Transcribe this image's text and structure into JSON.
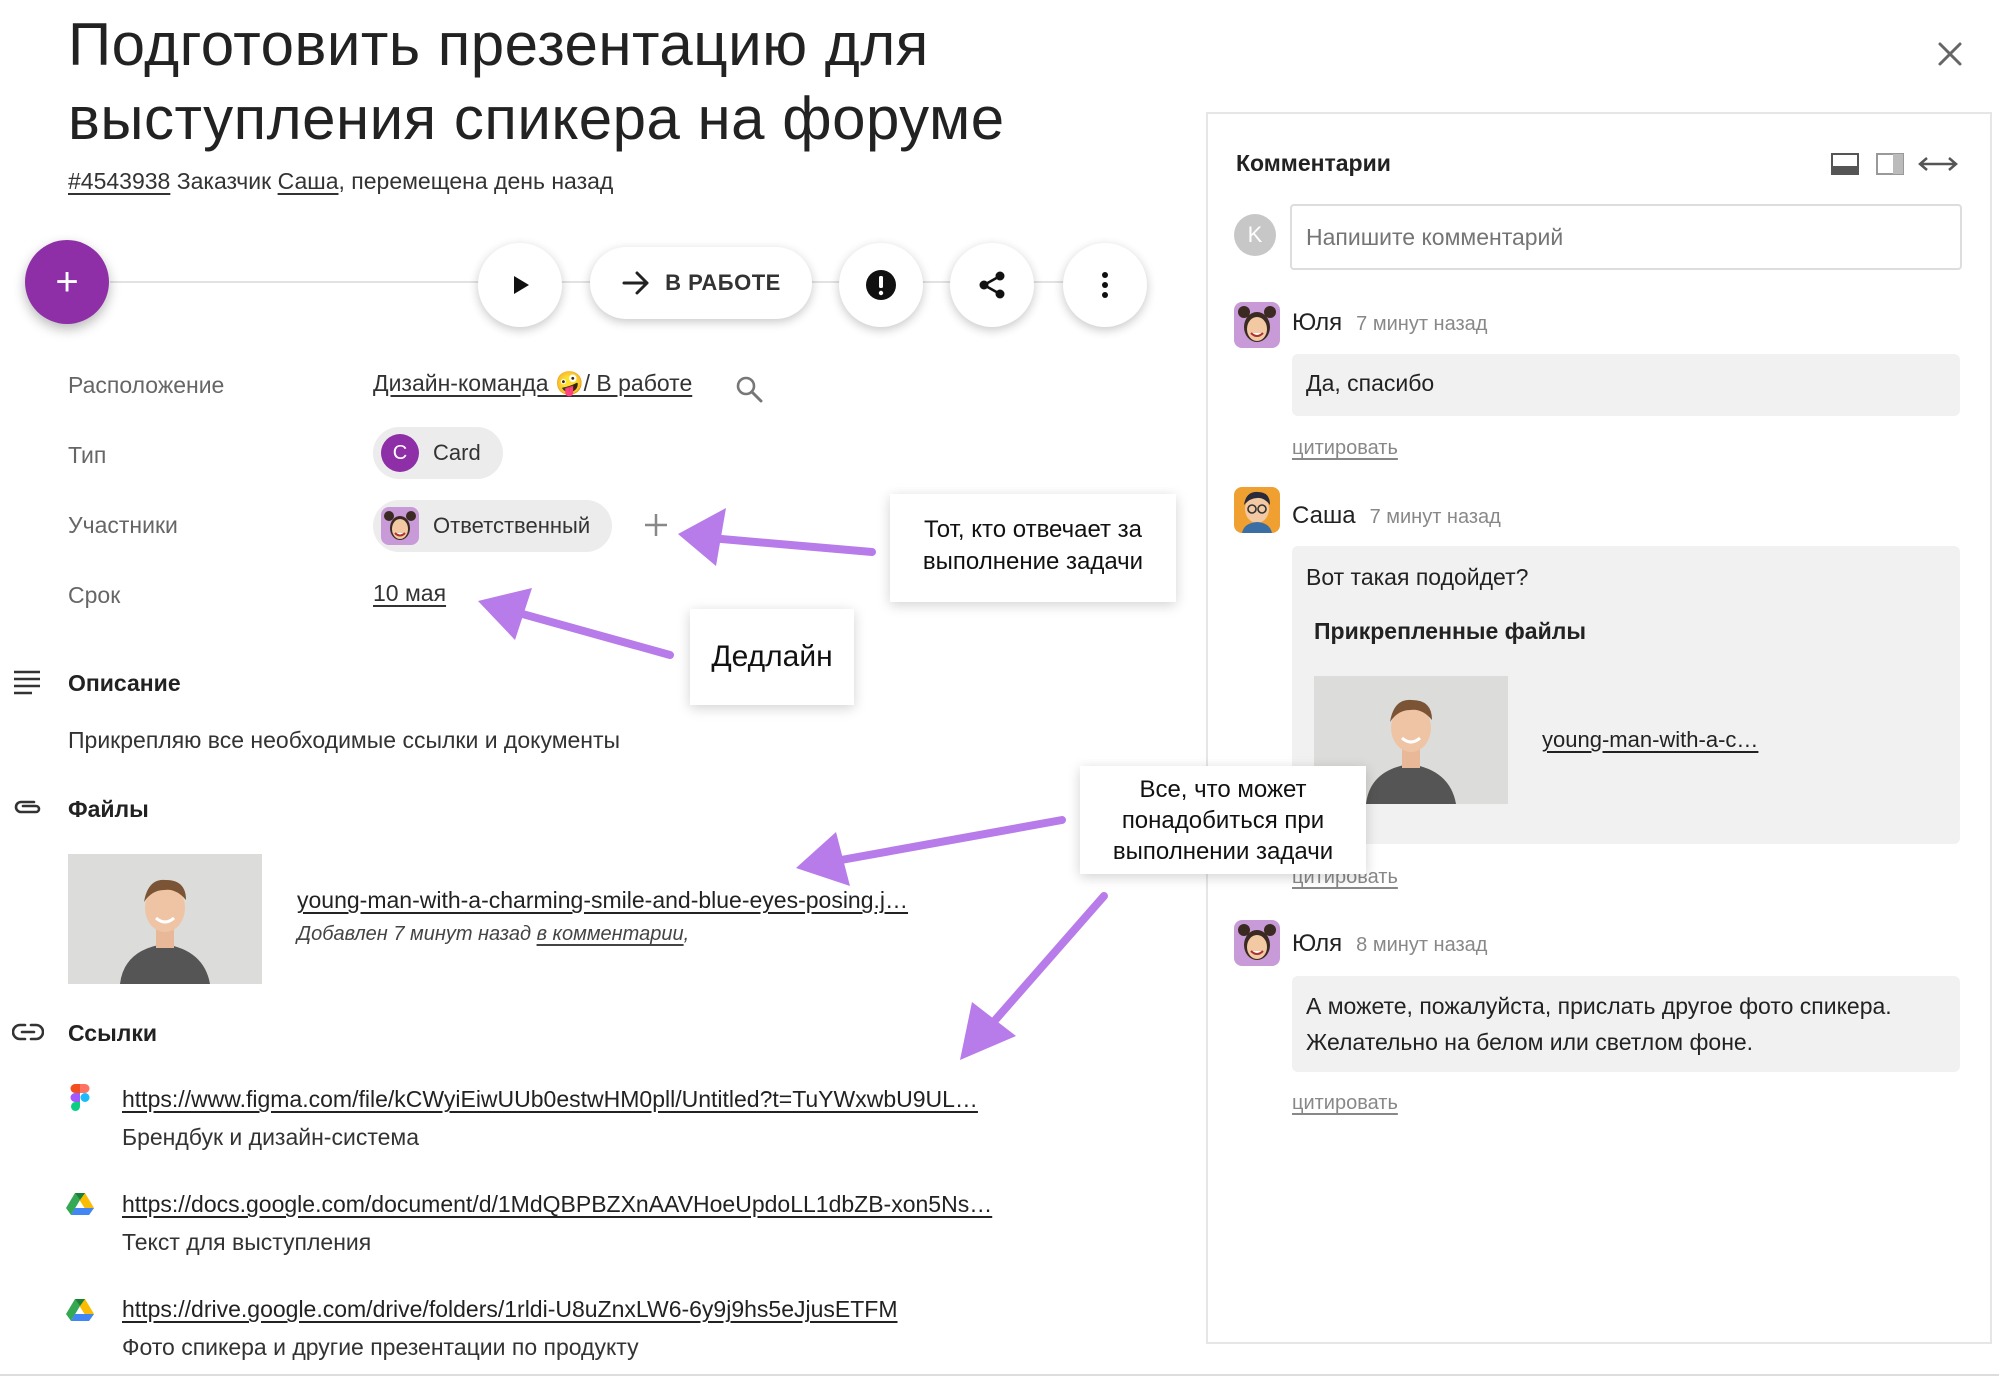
{
  "task": {
    "title": "Подготовить презентацию для выступления спикера на форуме",
    "id": "#4543938",
    "customer_prefix": "Заказчик",
    "customer": "Саша",
    "moved": ", перемещена день назад"
  },
  "toolbar": {
    "add_label": "+",
    "status_label": "В РАБОТЕ"
  },
  "properties": {
    "location_label": "Расположение",
    "location_value": "Дизайн-команда 🤪/ В работе",
    "type_label": "Тип",
    "type_badge": "C",
    "type_value": "Card",
    "participants_label": "Участники",
    "participant_role": "Ответственный",
    "deadline_label": "Срок",
    "deadline_value": "10 мая"
  },
  "description": {
    "heading": "Описание",
    "text": "Прикрепляю все необходимые ссылки и документы"
  },
  "files": {
    "heading": "Файлы",
    "items": [
      {
        "name": "young-man-with-a-charming-smile-and-blue-eyes-posing.j…",
        "added_prefix": "Добавлен 7 минут назад",
        "added_link": "в комментарии",
        "added_suffix": ","
      }
    ]
  },
  "links": {
    "heading": "Ссылки",
    "items": [
      {
        "icon": "figma-icon",
        "url": "https://www.figma.com/file/kCWyiEiwUUb0estwHM0pll/Untitled?t=TuYWxwbU9UL…",
        "desc": "Брендбук и дизайн-система"
      },
      {
        "icon": "google-drive-icon",
        "url": "https://docs.google.com/document/d/1MdQBPBZXnAAVHoeUpdoLL1dbZB-xon5Ns…",
        "desc": "Текст для выступления"
      },
      {
        "icon": "google-drive-icon",
        "url": "https://drive.google.com/drive/folders/1rldi-U8uZnxLW6-6y9j9hs5eJjusETFM",
        "desc": "Фото спикера и другие презентации по продукту"
      }
    ]
  },
  "callouts": {
    "participants": "Тот, кто отвечает за выполнение задачи",
    "deadline": "Дедлайн",
    "files": "Все, что может понадобиться при выполнении задачи"
  },
  "comments": {
    "title": "Комментарии",
    "input_placeholder": "Напишите комментарий",
    "current_user_initial": "K",
    "quote_label": "цитировать",
    "attached_heading": "Прикрепленные файлы",
    "items": [
      {
        "author": "Юля",
        "time": "7 минут назад",
        "text": "Да, спасибо"
      },
      {
        "author": "Саша",
        "time": "7 минут назад",
        "text": "Вот такая подойдет?",
        "attachment": "young-man-with-a-c…"
      },
      {
        "author": "Юля",
        "time": "8 минут назад",
        "text": "А можете, пожалуйста, прислать другое фото спикера. Желательно на белом или светлом фоне."
      }
    ]
  },
  "colors": {
    "accent": "#8e2fa8",
    "arrow": "#b77bea"
  }
}
